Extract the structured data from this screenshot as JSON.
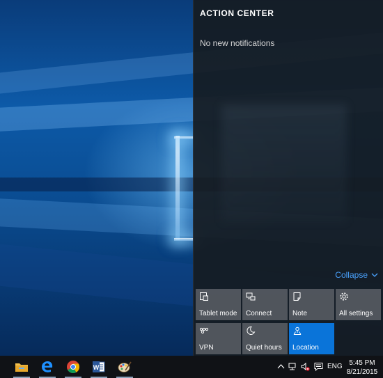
{
  "action_center": {
    "title": "ACTION CENTER",
    "empty_message": "No new notifications",
    "collapse_label": "Collapse",
    "tiles": [
      {
        "label": "Tablet mode",
        "icon": "tablet-mode-icon",
        "active": false
      },
      {
        "label": "Connect",
        "icon": "connect-icon",
        "active": false
      },
      {
        "label": "Note",
        "icon": "note-icon",
        "active": false
      },
      {
        "label": "All settings",
        "icon": "gear-icon",
        "active": false
      },
      {
        "label": "VPN",
        "icon": "vpn-icon",
        "active": false
      },
      {
        "label": "Quiet hours",
        "icon": "moon-icon",
        "active": false
      },
      {
        "label": "Location",
        "icon": "location-icon",
        "active": true
      }
    ]
  },
  "taskbar": {
    "apps": [
      {
        "name": "File Explorer",
        "icon": "folder-icon"
      },
      {
        "name": "Microsoft Edge",
        "icon": "edge-icon"
      },
      {
        "name": "Google Chrome",
        "icon": "chrome-icon"
      },
      {
        "name": "Microsoft Word",
        "icon": "word-icon"
      },
      {
        "name": "Paint",
        "icon": "paint-icon"
      }
    ],
    "tray": {
      "language": "ENG",
      "time": "5:45 PM",
      "date": "8/21/2015"
    }
  },
  "colors": {
    "accent": "#0a74d9",
    "link": "#4aa3ff",
    "panel": "#161b21"
  }
}
